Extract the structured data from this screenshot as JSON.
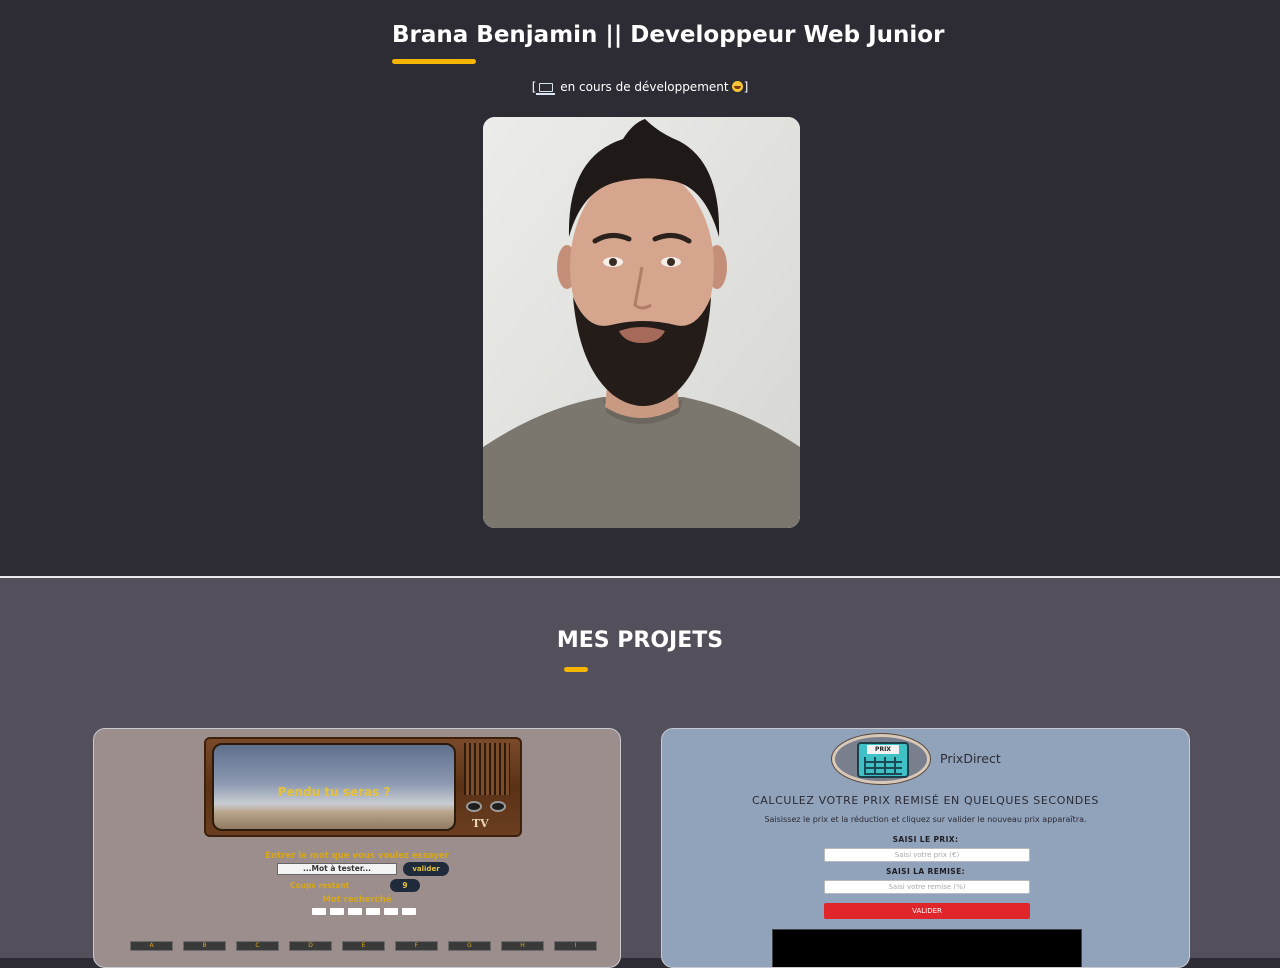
{
  "header": {
    "title": "Brana Benjamin  ||  Developpeur Web Junior",
    "status_open": "[",
    "status_text": "en cours de développement",
    "status_close": "]",
    "status_icons": [
      "laptop-icon",
      "grinning-face-icon"
    ]
  },
  "colors": {
    "hero_bg": "#2d2b33",
    "projects_bg": "#53505c",
    "accent": "#f5b400"
  },
  "projects": {
    "title": "MES PROJETS",
    "pendu": {
      "screen_title": "Pendu tu seras ?",
      "tv_logo": "TV",
      "prompt": "Entrer le mot que vous voulez essayer",
      "input_placeholder": "...Mot à tester...",
      "valider": "valider",
      "coups_label": "Coups restant",
      "coups_value": "9",
      "mot_label": "Mot recherché",
      "keys": [
        "A",
        "B",
        "C",
        "D",
        "E",
        "F",
        "G",
        "H",
        "I"
      ]
    },
    "prix": {
      "logo_label": "PRIX",
      "brand": "PrixDirect",
      "headline": "CALCULEZ VOTRE PRIX REMISÉ EN QUELQUES SECONDES",
      "subtitle": "Saisissez le prix et la réduction et cliquez sur valider le nouveau prix apparaîtra.",
      "price_label": "SAISI LE PRIX:",
      "price_placeholder": "Saisi votre prix (€)",
      "discount_label": "SAISI LA REMISE:",
      "discount_placeholder": "Saisi votre remise (%)",
      "valider": "VALIDER"
    }
  }
}
